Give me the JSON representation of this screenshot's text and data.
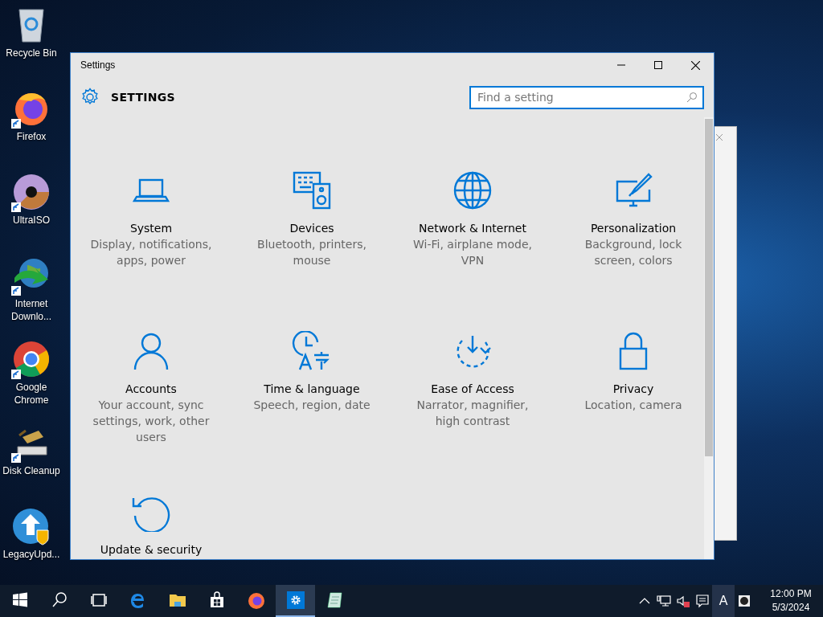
{
  "desktop_icons": [
    {
      "kind": "recycle",
      "label": "Recycle Bin",
      "shortcut": false
    },
    {
      "kind": "firefox",
      "label": "Firefox",
      "shortcut": true
    },
    {
      "kind": "disc",
      "label": "UltraISO",
      "shortcut": true
    },
    {
      "kind": "globe",
      "label": "Internet Downlo...",
      "shortcut": true
    },
    {
      "kind": "chrome",
      "label": "Google Chrome",
      "shortcut": true
    },
    {
      "kind": "cleanup",
      "label": "Disk Cleanup",
      "shortcut": true
    },
    {
      "kind": "update",
      "label": "LegacyUpd...",
      "shortcut": false
    }
  ],
  "window": {
    "title": "Settings",
    "header": "SETTINGS",
    "search": {
      "placeholder": "Find a setting"
    }
  },
  "categories": [
    {
      "kind": "laptop",
      "title": "System",
      "description": "Display, notifications, apps, power"
    },
    {
      "kind": "devices",
      "title": "Devices",
      "description": "Bluetooth, printers, mouse"
    },
    {
      "kind": "globe",
      "title": "Network & Internet",
      "description": "Wi-Fi, airplane mode, VPN"
    },
    {
      "kind": "paint",
      "title": "Personalization",
      "description": "Background, lock screen, colors"
    },
    {
      "kind": "person",
      "title": "Accounts",
      "description": "Your account, sync settings, work, other users"
    },
    {
      "kind": "time",
      "title": "Time & language",
      "description": "Speech, region, date"
    },
    {
      "kind": "ease",
      "title": "Ease of Access",
      "description": "Narrator, magnifier, high contrast"
    },
    {
      "kind": "lock",
      "title": "Privacy",
      "description": "Location, camera"
    },
    {
      "kind": "update",
      "title": "Update & security"
    }
  ],
  "taskbar": {
    "items": [
      {
        "kind": "start",
        "selected": false
      },
      {
        "kind": "search",
        "selected": false
      },
      {
        "kind": "taskview",
        "selected": false
      },
      {
        "kind": "edge",
        "selected": false
      },
      {
        "kind": "explorer",
        "selected": false
      },
      {
        "kind": "store",
        "selected": false
      },
      {
        "kind": "firefox",
        "selected": false
      },
      {
        "kind": "settings",
        "selected": true
      },
      {
        "kind": "notepad",
        "selected": false
      }
    ],
    "tray": [
      {
        "kind": "chevron"
      },
      {
        "kind": "network"
      },
      {
        "kind": "volume_muted"
      },
      {
        "kind": "action_center"
      },
      {
        "kind": "text",
        "text": "A"
      },
      {
        "kind": "app"
      }
    ],
    "time": "12:00 PM",
    "date": "5/3/2024"
  }
}
